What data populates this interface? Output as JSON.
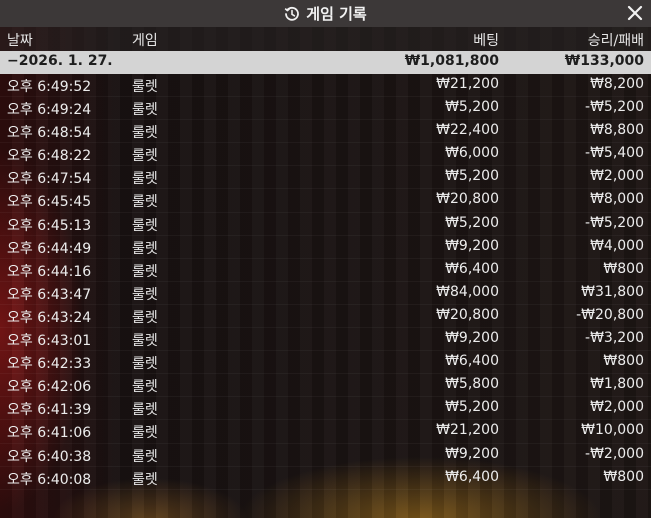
{
  "title": "게임 기록",
  "icons": {
    "history": "history-icon",
    "close": "close-icon"
  },
  "header": {
    "date": "날짜",
    "game": "게임",
    "bet": "베팅",
    "winloss": "승리/패배"
  },
  "summary": {
    "date": "−2026. 1. 27.",
    "bet": "₩1,081,800",
    "winloss": "₩133,000"
  },
  "rows": [
    {
      "time": "오후 6:49:52",
      "game": "룰렛",
      "bet": "₩21,200",
      "result": "₩8,200"
    },
    {
      "time": "오후 6:49:24",
      "game": "룰렛",
      "bet": "₩5,200",
      "result": "-₩5,200"
    },
    {
      "time": "오후 6:48:54",
      "game": "룰렛",
      "bet": "₩22,400",
      "result": "₩8,800"
    },
    {
      "time": "오후 6:48:22",
      "game": "룰렛",
      "bet": "₩6,000",
      "result": "-₩5,400"
    },
    {
      "time": "오후 6:47:54",
      "game": "룰렛",
      "bet": "₩5,200",
      "result": "₩2,000"
    },
    {
      "time": "오후 6:45:45",
      "game": "룰렛",
      "bet": "₩20,800",
      "result": "₩8,000"
    },
    {
      "time": "오후 6:45:13",
      "game": "룰렛",
      "bet": "₩5,200",
      "result": "-₩5,200"
    },
    {
      "time": "오후 6:44:49",
      "game": "룰렛",
      "bet": "₩9,200",
      "result": "₩4,000"
    },
    {
      "time": "오후 6:44:16",
      "game": "룰렛",
      "bet": "₩6,400",
      "result": "₩800"
    },
    {
      "time": "오후 6:43:47",
      "game": "룰렛",
      "bet": "₩84,000",
      "result": "₩31,800"
    },
    {
      "time": "오후 6:43:24",
      "game": "룰렛",
      "bet": "₩20,800",
      "result": "-₩20,800"
    },
    {
      "time": "오후 6:43:01",
      "game": "룰렛",
      "bet": "₩9,200",
      "result": "-₩3,200"
    },
    {
      "time": "오후 6:42:33",
      "game": "룰렛",
      "bet": "₩6,400",
      "result": "₩800"
    },
    {
      "time": "오후 6:42:06",
      "game": "룰렛",
      "bet": "₩5,800",
      "result": "₩1,800"
    },
    {
      "time": "오후 6:41:39",
      "game": "룰렛",
      "bet": "₩5,200",
      "result": "₩2,000"
    },
    {
      "time": "오후 6:41:06",
      "game": "룰렛",
      "bet": "₩21,200",
      "result": "₩10,000"
    },
    {
      "time": "오후 6:40:38",
      "game": "룰렛",
      "bet": "₩9,200",
      "result": "-₩2,000"
    },
    {
      "time": "오후 6:40:08",
      "game": "룰렛",
      "bet": "₩6,400",
      "result": "₩800"
    }
  ]
}
